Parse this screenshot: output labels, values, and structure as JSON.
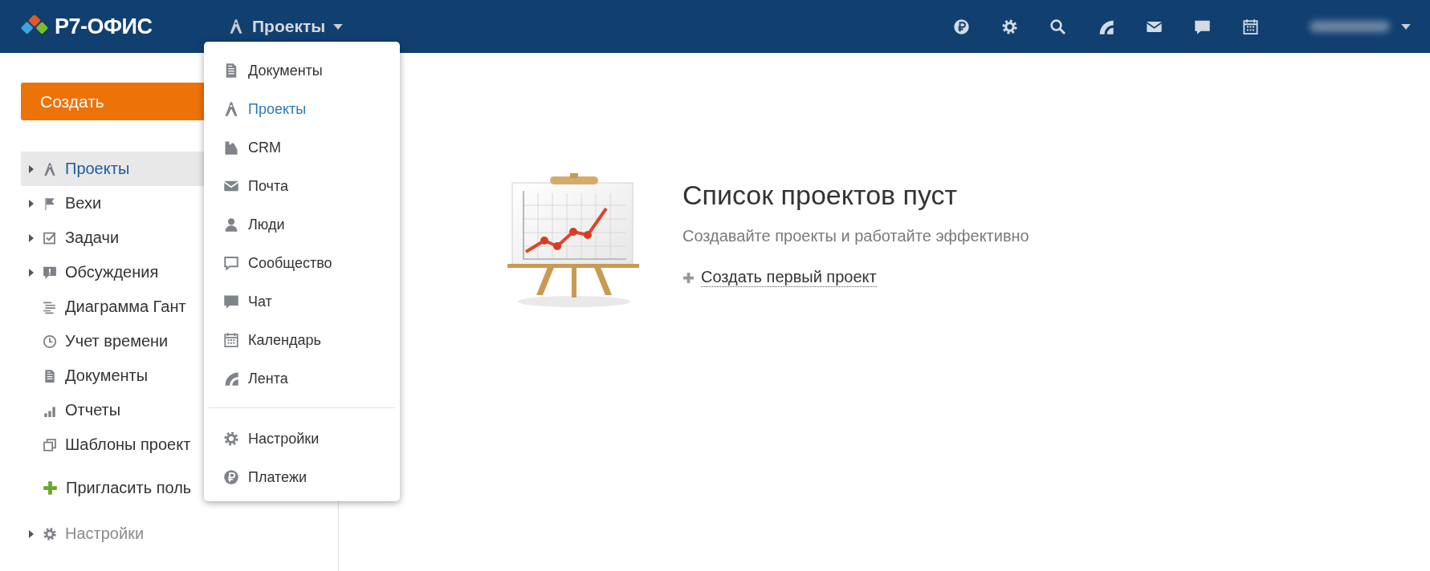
{
  "header": {
    "logo": "Р7-ОФИС",
    "module_menu": {
      "label": "Проекты",
      "expanded": true
    },
    "tools": [
      {
        "kind": "payments"
      },
      {
        "kind": "settings"
      },
      {
        "kind": "search"
      },
      {
        "kind": "feed"
      },
      {
        "kind": "mail"
      },
      {
        "kind": "chat"
      },
      {
        "kind": "calendar"
      }
    ]
  },
  "sidebar": {
    "create_button": "Создать",
    "items": [
      {
        "label": "Проекты",
        "kind": "projects",
        "has_children": true,
        "selected": true
      },
      {
        "label": "Вехи",
        "kind": "milestones",
        "has_children": true,
        "selected": false
      },
      {
        "label": "Задачи",
        "kind": "tasks",
        "has_children": true,
        "selected": false
      },
      {
        "label": "Обсуждения",
        "kind": "discussions",
        "has_children": true,
        "selected": false
      },
      {
        "label": "Диаграмма Гант",
        "kind": "gantt",
        "has_children": false,
        "selected": false
      },
      {
        "label": "Учет времени",
        "kind": "time",
        "has_children": false,
        "selected": false
      },
      {
        "label": "Документы",
        "kind": "documents",
        "has_children": false,
        "selected": false
      },
      {
        "label": "Отчеты",
        "kind": "reports",
        "has_children": false,
        "selected": false
      },
      {
        "label": "Шаблоны проект",
        "kind": "templates",
        "has_children": false,
        "selected": false
      }
    ],
    "invite": "Пригласить поль",
    "settings": {
      "label": "Настройки",
      "has_children": true,
      "disabled": true
    }
  },
  "module_dropdown": {
    "items": [
      {
        "label": "Документы",
        "kind": "documents",
        "selected": false
      },
      {
        "label": "Проекты",
        "kind": "projects",
        "selected": true
      },
      {
        "label": "CRM",
        "kind": "crm",
        "selected": false
      },
      {
        "label": "Почта",
        "kind": "mail",
        "selected": false
      },
      {
        "label": "Люди",
        "kind": "people",
        "selected": false
      },
      {
        "label": "Сообщество",
        "kind": "community",
        "selected": false
      },
      {
        "label": "Чат",
        "kind": "chat",
        "selected": false
      },
      {
        "label": "Календарь",
        "kind": "calendar",
        "selected": false
      },
      {
        "label": "Лента",
        "kind": "feed",
        "selected": false
      }
    ],
    "bottom_items": [
      {
        "label": "Настройки",
        "kind": "settings",
        "selected": false
      },
      {
        "label": "Платежи",
        "kind": "payments",
        "selected": false
      }
    ]
  },
  "empty_state": {
    "title": "Список проектов пуст",
    "subtitle": "Создавайте проекты и работайте эффективно",
    "action": "Создать первый проект"
  }
}
